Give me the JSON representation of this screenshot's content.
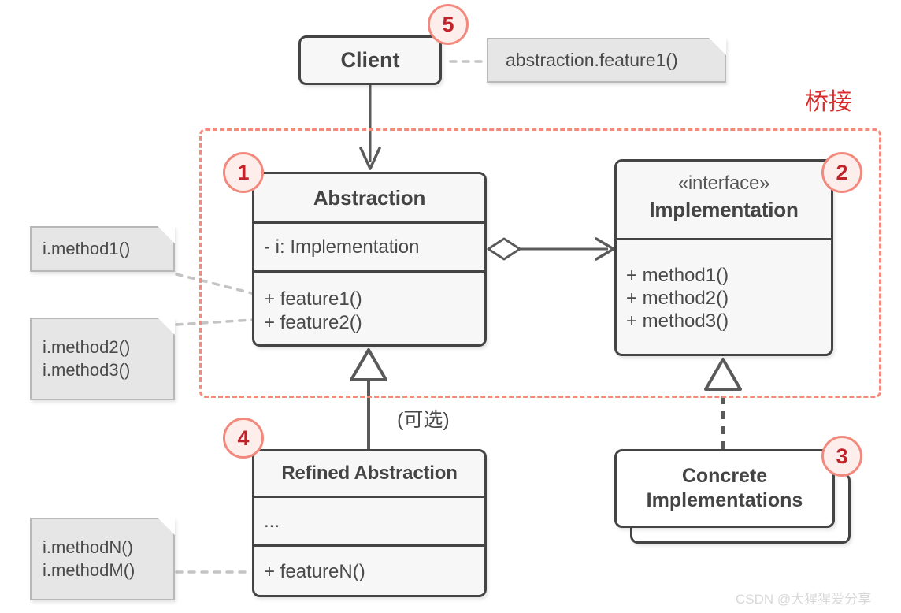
{
  "diagram": {
    "scope_label": "桥接",
    "optional_label": "(可选)",
    "watermark": "CSDN @大猩猩爱分享"
  },
  "classes": {
    "client": {
      "title": "Client"
    },
    "abstraction": {
      "title": "Abstraction",
      "attributes": [
        "- i: Implementation"
      ],
      "operations": [
        "+ feature1()",
        "+ feature2()"
      ]
    },
    "implementation": {
      "stereotype": "«interface»",
      "title": "Implementation",
      "operations": [
        "+ method1()",
        "+ method2()",
        "+ method3()"
      ]
    },
    "refined_abstraction": {
      "title": "Refined Abstraction",
      "attributes": [
        "..."
      ],
      "operations": [
        "+ featureN()"
      ]
    },
    "concrete_implementations": {
      "title_line1": "Concrete",
      "title_line2": "Implementations"
    }
  },
  "notes": {
    "client_call": {
      "lines": [
        "abstraction.feature1()"
      ]
    },
    "method1": {
      "lines": [
        "i.method1()"
      ]
    },
    "method23": {
      "lines": [
        "i.method2()",
        "i.method3()"
      ]
    },
    "methodNM": {
      "lines": [
        "i.methodN()",
        "i.methodM()"
      ]
    }
  },
  "badges": [
    {
      "number": "1"
    },
    {
      "number": "2"
    },
    {
      "number": "3"
    },
    {
      "number": "4"
    },
    {
      "number": "5"
    }
  ],
  "colors": {
    "badge_fill": "#fdeeec",
    "badge_border": "#f2897c",
    "badge_text": "#c0242b",
    "scope_border": "#f4897c",
    "scope_label": "#d92b2b",
    "box_border": "#444444",
    "box_fill": "#f7f7f7",
    "note_fill": "#e6e6e6",
    "note_border": "#b8b8b8",
    "edge": "#5a5a5a",
    "note_link": "#bfbfbf"
  }
}
